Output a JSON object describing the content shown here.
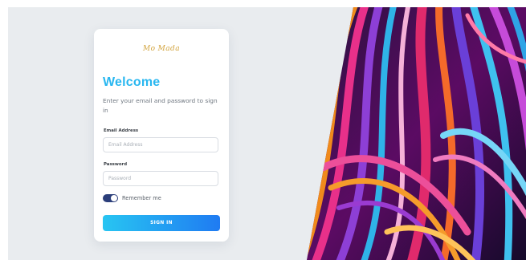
{
  "brand": {
    "logo_text": "Mo Mada"
  },
  "login": {
    "title": "Welcome",
    "subtitle": "Enter your email and password to sign in",
    "email_label": "Email Address",
    "email_placeholder": "Email Address",
    "email_value": "",
    "password_label": "Password",
    "password_placeholder": "Password",
    "password_value": "",
    "remember_label": "Remember me",
    "remember_checked": true,
    "signin_label": "SIGN IN"
  },
  "colors": {
    "background": "#e9ecef",
    "title": "#29b7f0",
    "button_start": "#28c5f2",
    "button_end": "#1f7bf2",
    "toggle": "#2b3e7a",
    "logo": "#d2a33c"
  },
  "icons": {
    "toggle": "toggle-switch-icon"
  }
}
